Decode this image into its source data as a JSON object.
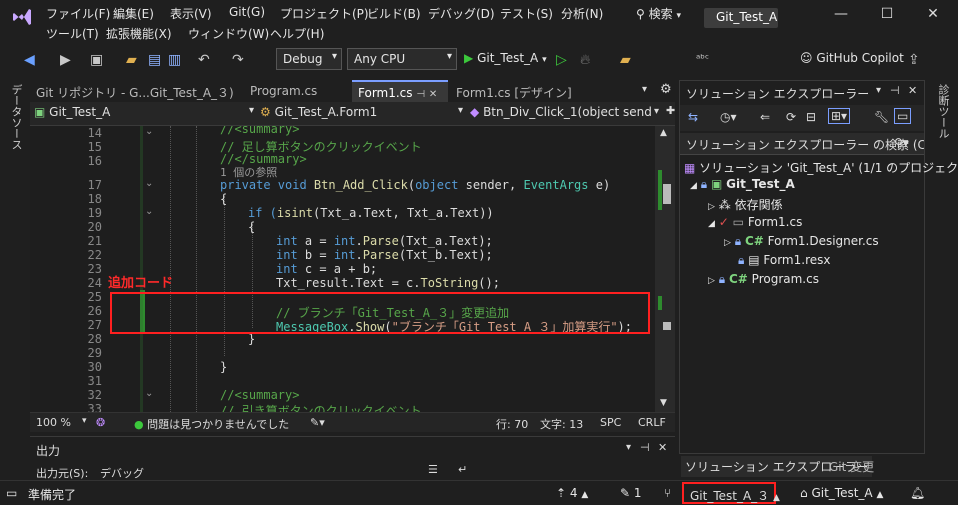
{
  "menu": {
    "file": "ファイル(F)",
    "edit": "編集(E)",
    "view": "表示(V)",
    "git": "Git(G)",
    "project": "プロジェクト(P)",
    "build": "ビルド(B)",
    "debug": "デバッグ(D)",
    "test": "テスト(S)",
    "analyze": "分析(N)",
    "tools": "ツール(T)",
    "extensions": "拡張機能(X)",
    "window": "ウィンドウ(W)",
    "help": "ヘルプ(H)",
    "search": "検索",
    "solution_name": "Git_Test_A"
  },
  "toolbar": {
    "config": "Debug",
    "platform": "Any CPU",
    "start": "Git_Test_A",
    "copilot": "GitHub Copilot"
  },
  "side": {
    "left": "データソース",
    "right": "診断ツール"
  },
  "tabs": [
    {
      "label": "Git リポジトリ - G...Git_Test_A_３)"
    },
    {
      "label": "Program.cs"
    },
    {
      "label": "Form1.cs"
    },
    {
      "label": "Form1.cs [デザイン]"
    }
  ],
  "nav": {
    "project": "Git_Test_A",
    "class": "Git_Test_A.Form1",
    "member": "Btn_Div_Click_1(object sender, E"
  },
  "code": {
    "lines": [
      "14",
      "15",
      "16",
      "17",
      "18",
      "19",
      "20",
      "21",
      "22",
      "23",
      "24",
      "25",
      "26",
      "27",
      "28",
      "29",
      "30",
      "31",
      "32",
      "33"
    ],
    "l14": "//<summary>",
    "l15": "// 足し算ボタンのクリックイベント",
    "l16": "//</summary>",
    "ref": "1 個の参照",
    "l17a": "private void ",
    "l17b": "Btn_Add_Click",
    "l17c": "(",
    "l17d": "object",
    "l17e": " sender, ",
    "l17f": "EventArgs",
    "l17g": " e)",
    "l18": "{",
    "l19a": "if (",
    "l19b": "isint",
    "l19c": "(Txt_a.Text, Txt_a.Text))",
    "l20": "{",
    "l21a": "int",
    "l21b": " a = ",
    "l21c": "int",
    "l21d": ".",
    "l21e": "Parse",
    "l21f": "(Txt_a.Text);",
    "l22a": "int",
    "l22b": " b = ",
    "l22c": "int",
    "l22d": ".",
    "l22e": "Parse",
    "l22f": "(Txt_b.Text);",
    "l23a": "int",
    "l23b": " c = a + b;",
    "l24a": "Txt_result.Text = c.",
    "l24b": "ToString",
    "l24c": "();",
    "l26": "// ブランチ「Git_Test_A_３」変更追加",
    "l27a": "MessageBox",
    "l27b": ".",
    "l27c": "Show",
    "l27d": "(",
    "l27e": "\"ブランチ「Git_Test_A_３」加算実行\"",
    "l27f": ");",
    "l28": "}",
    "l30": "}",
    "l32": "//<summary>",
    "l33": "// 引き算ボタンのクリックイベント"
  },
  "annotation": {
    "label": "追加コード",
    "color": "#ff2020"
  },
  "editor_status": {
    "zoom": "100 %",
    "issues": "問題は見つかりませんでした",
    "line": "行: 70",
    "col": "文字: 13",
    "spc": "SPC",
    "crlf": "CRLF"
  },
  "output": {
    "title": "出力",
    "source_label": "出力元(S):",
    "source_value": "デバッグ"
  },
  "solution": {
    "title": "ソリューション エクスプローラー",
    "search": "ソリューション エクスプローラー の検索 (Ctrl+",
    "items": [
      {
        "label": "ソリューション 'Git_Test_A' (1/1 のプロジェクト"
      },
      {
        "label": "Git_Test_A"
      },
      {
        "label": "依存関係"
      },
      {
        "label": "Form1.cs"
      },
      {
        "label": "Form1.Designer.cs"
      },
      {
        "label": "Form1.resx"
      },
      {
        "label": "Program.cs"
      }
    ],
    "bottom_tab1": "ソリューション エクスプローラー",
    "bottom_tab2": "Git 変更"
  },
  "status": {
    "ready": "準備完了",
    "up": "4",
    "changes": "1",
    "branch": "Git_Test_A_３",
    "repo": "Git_Test_A"
  }
}
